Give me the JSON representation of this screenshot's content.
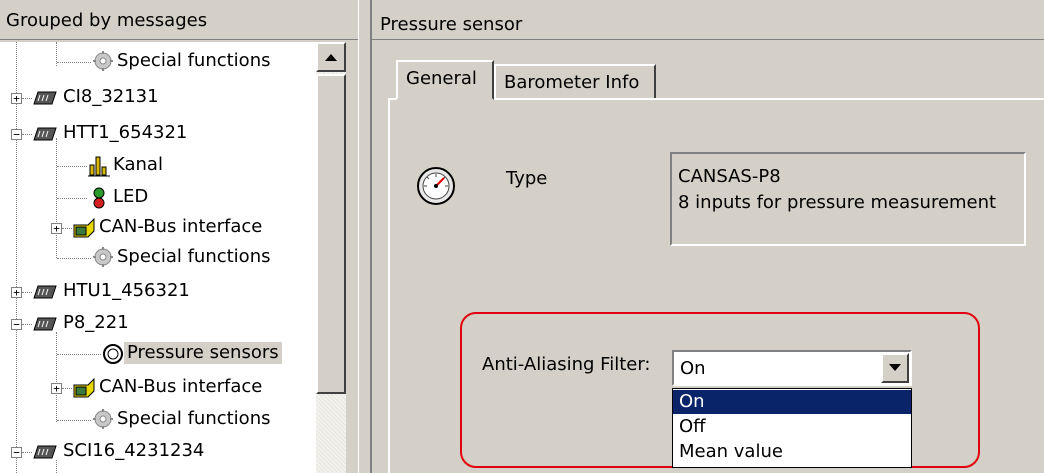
{
  "left_panel": {
    "header": "Grouped by messages",
    "tree": [
      {
        "label": "Special functions",
        "icon": "gear-icon"
      },
      {
        "label": "CI8_32131",
        "icon": "module-icon",
        "expander": "+"
      },
      {
        "label": "HTT1_654321",
        "icon": "module-icon",
        "expander": "−"
      },
      {
        "label": "Kanal",
        "icon": "bar-chart-icon"
      },
      {
        "label": "LED",
        "icon": "led-icon"
      },
      {
        "label": "CAN-Bus interface",
        "icon": "can-bus-icon",
        "expander": "+"
      },
      {
        "label": "Special functions",
        "icon": "gear-icon"
      },
      {
        "label": "HTU1_456321",
        "icon": "module-icon",
        "expander": "+"
      },
      {
        "label": "P8_221",
        "icon": "module-icon",
        "expander": "−"
      },
      {
        "label": "Pressure sensors",
        "icon": "gauge-icon",
        "selected": true
      },
      {
        "label": "CAN-Bus interface",
        "icon": "can-bus-icon",
        "expander": "+"
      },
      {
        "label": "Special functions",
        "icon": "gear-icon"
      },
      {
        "label": "SCI16_4231234",
        "icon": "module-icon",
        "expander": "−"
      }
    ]
  },
  "right_panel": {
    "title": "Pressure sensor",
    "tabs": [
      {
        "label": "General",
        "active": true
      },
      {
        "label": "Barometer Info",
        "active": false
      }
    ],
    "type_label": "Type",
    "type_value_line1": "CANSAS-P8",
    "type_value_line2": "8 inputs for pressure measurement",
    "filter_label": "Anti-Aliasing Filter:",
    "filter_value": "On",
    "filter_options": [
      "On",
      "Off",
      "Mean value"
    ],
    "highlight_color": "#e0000e",
    "selection_color": "#0a246a"
  }
}
